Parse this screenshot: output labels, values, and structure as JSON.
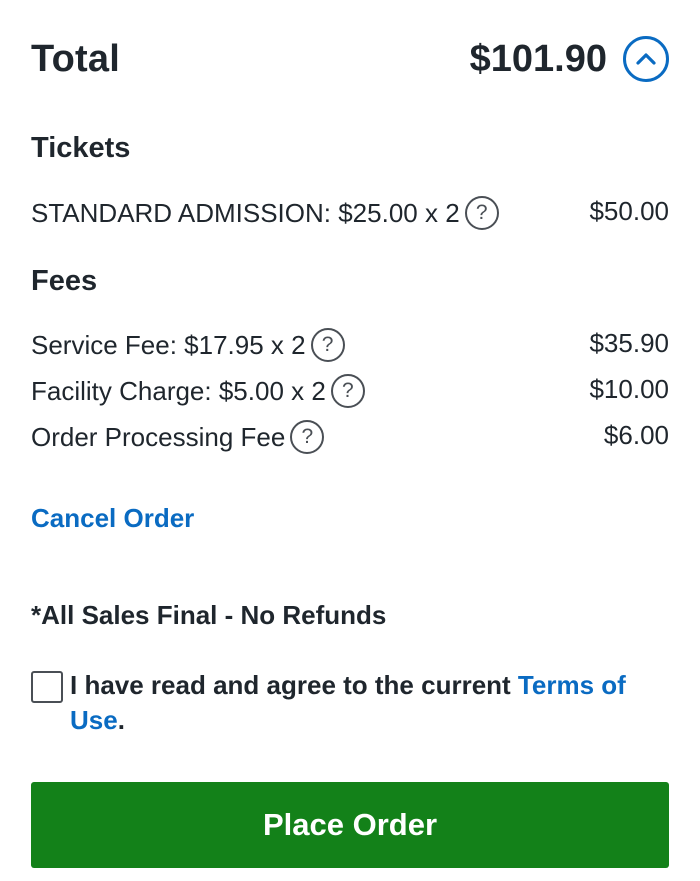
{
  "total": {
    "label": "Total",
    "amount": "$101.90",
    "toggle_icon": "chevron-up-icon"
  },
  "tickets": {
    "title": "Tickets",
    "items": [
      {
        "label": "STANDARD ADMISSION: $25.00 x 2",
        "amount": "$50.00"
      }
    ]
  },
  "fees": {
    "title": "Fees",
    "items": [
      {
        "label": "Service Fee: $17.95 x 2",
        "amount": "$35.90"
      },
      {
        "label": "Facility Charge: $5.00 x 2",
        "amount": "$10.00"
      },
      {
        "label": "Order Processing Fee",
        "amount": "$6.00"
      }
    ]
  },
  "help_icon_glyph": "?",
  "cancel_label": "Cancel Order",
  "notice": "*All Sales Final - No Refunds",
  "terms": {
    "prefix": "I have read and agree to the current ",
    "link": "Terms of Use",
    "suffix": "."
  },
  "place_order_label": "Place Order",
  "colors": {
    "accent_blue": "#0a6bc2",
    "button_green": "#138119",
    "text": "#1f262d"
  }
}
